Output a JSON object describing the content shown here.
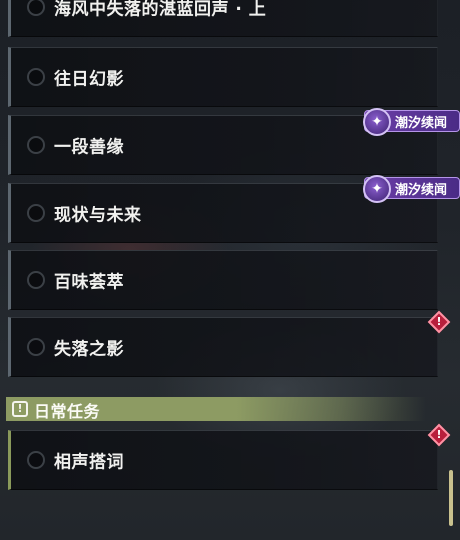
{
  "quests": [
    {
      "title": "海风中失落的湛蓝回声 · 上"
    },
    {
      "title": "往日幻影"
    },
    {
      "title": "一段善缘",
      "tag": "潮汐续闻"
    },
    {
      "title": "现状与未来",
      "tag": "潮汐续闻"
    },
    {
      "title": "百味荟萃"
    },
    {
      "title": "失落之影"
    }
  ],
  "section": {
    "title": "日常任务",
    "icon": "!"
  },
  "daily_quests": [
    {
      "title": "相声搭词"
    }
  ],
  "warning_mark": "!",
  "colors": {
    "tag_purple": "#6c3fa8",
    "daily_green": "#8d9b63",
    "warning_red": "#b81f3c"
  }
}
